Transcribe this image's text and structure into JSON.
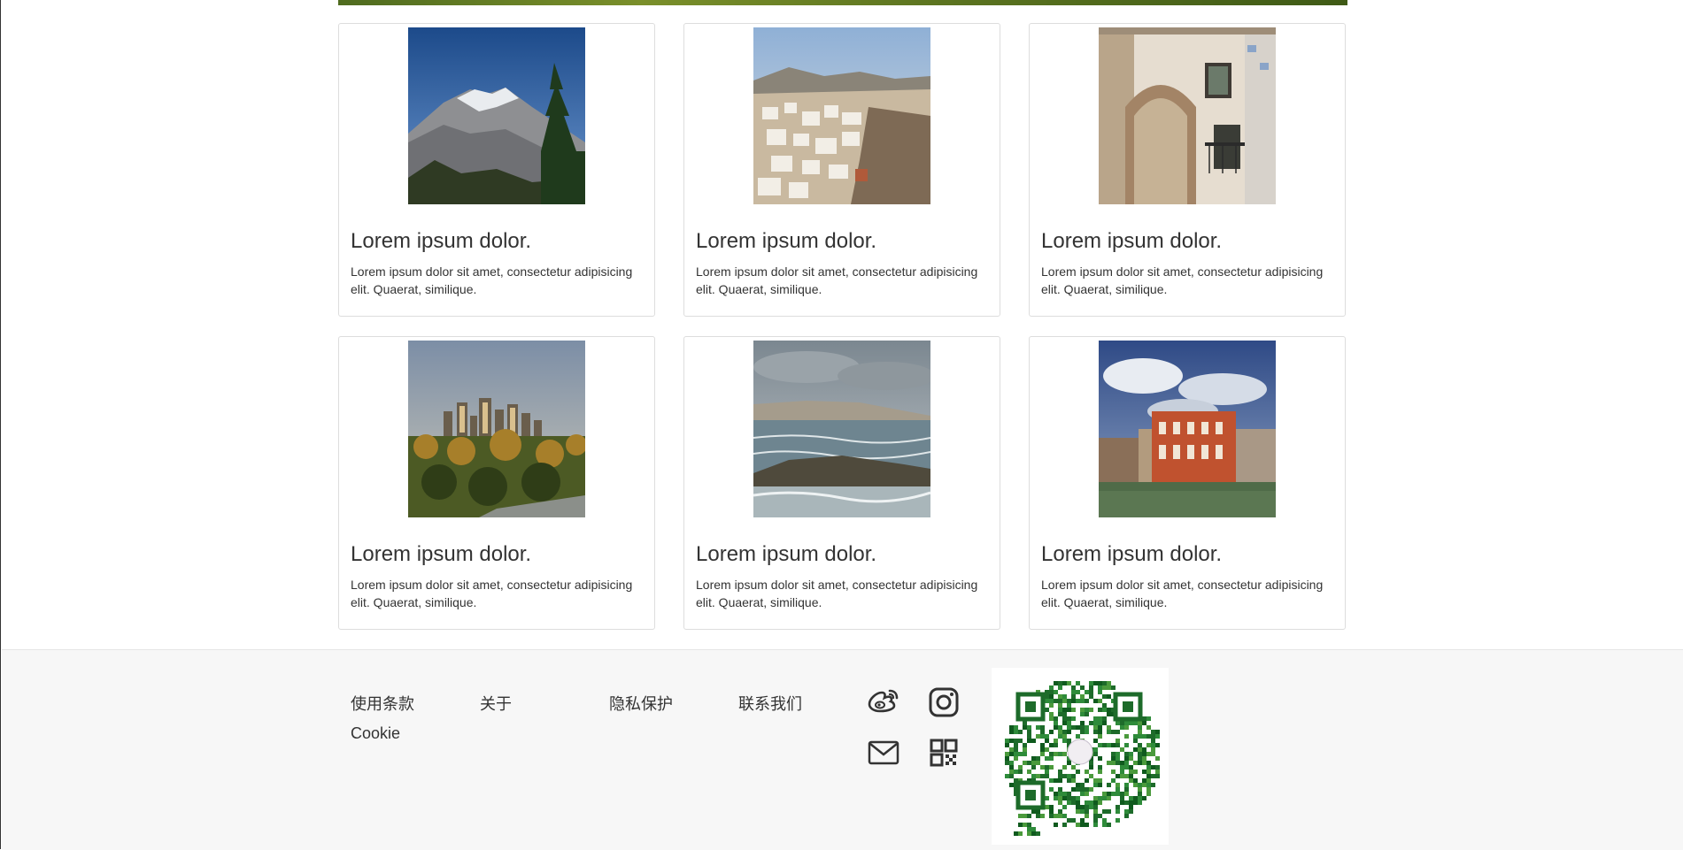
{
  "cards": [
    {
      "title": "Lorem ipsum dolor.",
      "text": "Lorem ipsum dolor sit amet, consectetur adipisicing elit. Quaerat, similique.",
      "image": "mountain-photo"
    },
    {
      "title": "Lorem ipsum dolor.",
      "text": "Lorem ipsum dolor sit amet, consectetur adipisicing elit. Quaerat, similique.",
      "image": "hillside-town-photo"
    },
    {
      "title": "Lorem ipsum dolor.",
      "text": "Lorem ipsum dolor sit amet, consectetur adipisicing elit. Quaerat, similique.",
      "image": "building-facade-photo"
    },
    {
      "title": "Lorem ipsum dolor.",
      "text": "Lorem ipsum dolor sit amet, consectetur adipisicing elit. Quaerat, similique.",
      "image": "city-skyline-photo"
    },
    {
      "title": "Lorem ipsum dolor.",
      "text": "Lorem ipsum dolor sit amet, consectetur adipisicing elit. Quaerat, similique.",
      "image": "coastline-photo"
    },
    {
      "title": "Lorem ipsum dolor.",
      "text": "Lorem ipsum dolor sit amet, consectetur adipisicing elit. Quaerat, similique.",
      "image": "venice-palace-photo"
    }
  ],
  "footer": {
    "links": {
      "terms": "使用条款",
      "about": "关于",
      "privacy": "隐私保护",
      "contact": "联系我们",
      "cookie": "Cookie"
    },
    "icons": [
      "weibo-icon",
      "instagram-icon",
      "mail-icon",
      "qrcode-icon"
    ],
    "qr_image": "wechat-qr-code"
  },
  "colors": {
    "footer_bg": "#f7f7f7",
    "card_border": "#dddddd",
    "text": "#333333"
  }
}
